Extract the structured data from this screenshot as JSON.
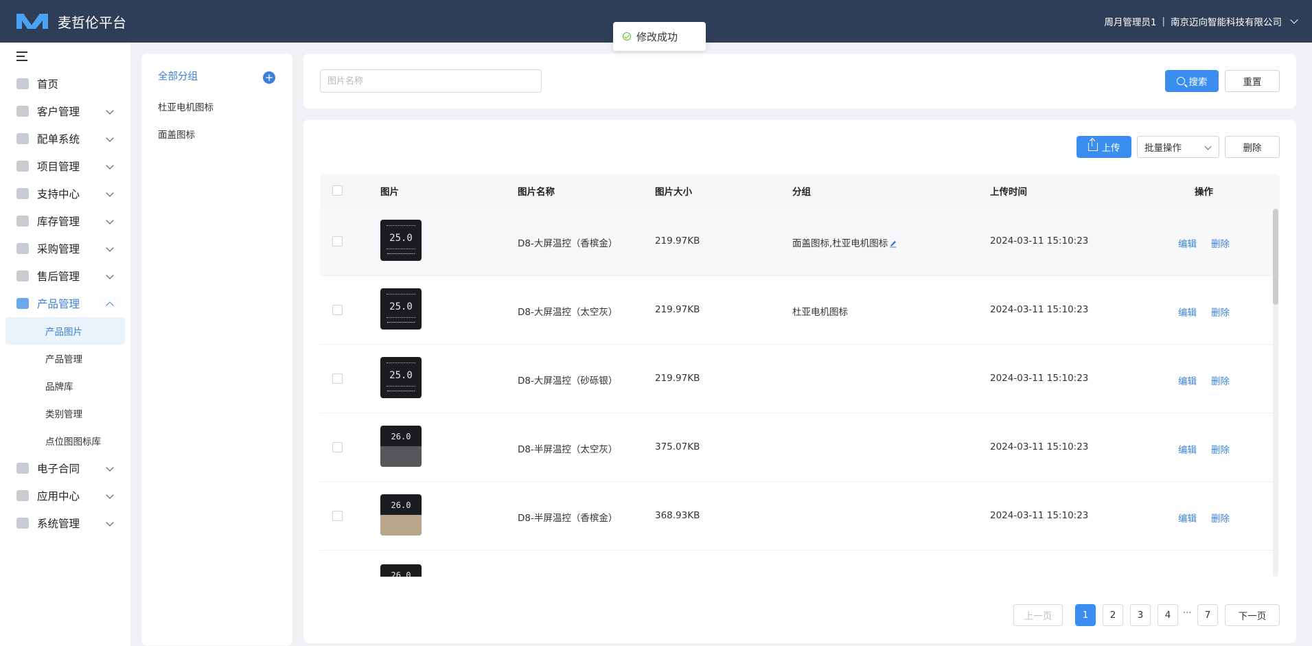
{
  "header": {
    "brand": "麦哲伦平台",
    "user": "周月管理员1",
    "separator": "|",
    "company": "南京迈向智能科技有限公司"
  },
  "toast": {
    "message": "修改成功"
  },
  "sidebar": {
    "items": [
      {
        "label": "首页"
      },
      {
        "label": "客户管理"
      },
      {
        "label": "配单系统"
      },
      {
        "label": "项目管理"
      },
      {
        "label": "支持中心"
      },
      {
        "label": "库存管理"
      },
      {
        "label": "采购管理"
      },
      {
        "label": "售后管理"
      },
      {
        "label": "产品管理"
      },
      {
        "label": "电子合同"
      },
      {
        "label": "应用中心"
      },
      {
        "label": "系统管理"
      }
    ],
    "sub_items": [
      {
        "label": "产品图片"
      },
      {
        "label": "产品管理"
      },
      {
        "label": "品牌库"
      },
      {
        "label": "类别管理"
      },
      {
        "label": "点位图图标库"
      }
    ]
  },
  "groups": {
    "all": "全部分组",
    "items": [
      "杜亚电机图标",
      "面盖图标"
    ]
  },
  "search": {
    "placeholder": "图片名称",
    "search_label": "搜索",
    "reset_label": "重置"
  },
  "toolbar": {
    "upload_label": "上传",
    "batch_label": "批量操作",
    "delete_label": "删除"
  },
  "table": {
    "columns": [
      "图片",
      "图片名称",
      "图片大小",
      "分组",
      "上传时间",
      "操作"
    ],
    "rows": [
      {
        "name": "D8-大屏温控（香槟金）",
        "size": "219.97KB",
        "group": "面盖图标,杜亚电机图标",
        "time": "2024-03-11 15:10:23",
        "lcd": "25.0",
        "edit": "编辑",
        "delete": "删除"
      },
      {
        "name": "D8-大屏温控（太空灰）",
        "size": "219.97KB",
        "group": "杜亚电机图标",
        "time": "2024-03-11 15:10:23",
        "lcd": "25.0",
        "edit": "编辑",
        "delete": "删除"
      },
      {
        "name": "D8-大屏温控（砂砾银）",
        "size": "219.97KB",
        "group": "",
        "time": "2024-03-11 15:10:23",
        "lcd": "25.0",
        "edit": "编辑",
        "delete": "删除"
      },
      {
        "name": "D8-半屏温控（太空灰）",
        "size": "375.07KB",
        "group": "",
        "time": "2024-03-11 15:10:23",
        "lcd": "26.0",
        "edit": "编辑",
        "delete": "删除"
      },
      {
        "name": "D8-半屏温控（香槟金）",
        "size": "368.93KB",
        "group": "",
        "time": "2024-03-11 15:10:23",
        "lcd": "26.0",
        "edit": "编辑",
        "delete": "删除"
      },
      {
        "name": "",
        "size": "",
        "group": "",
        "time": "",
        "lcd": "26.0",
        "edit": "",
        "delete": ""
      }
    ]
  },
  "pagination": {
    "prev": "上一页",
    "next": "下一页",
    "pages": [
      "1",
      "2",
      "3",
      "4",
      "7"
    ],
    "ellipsis": "···",
    "current": "1"
  },
  "colors": {
    "header_bg": "#2f3e58",
    "accent": "#3b8ef0",
    "link": "#3b82d6"
  }
}
